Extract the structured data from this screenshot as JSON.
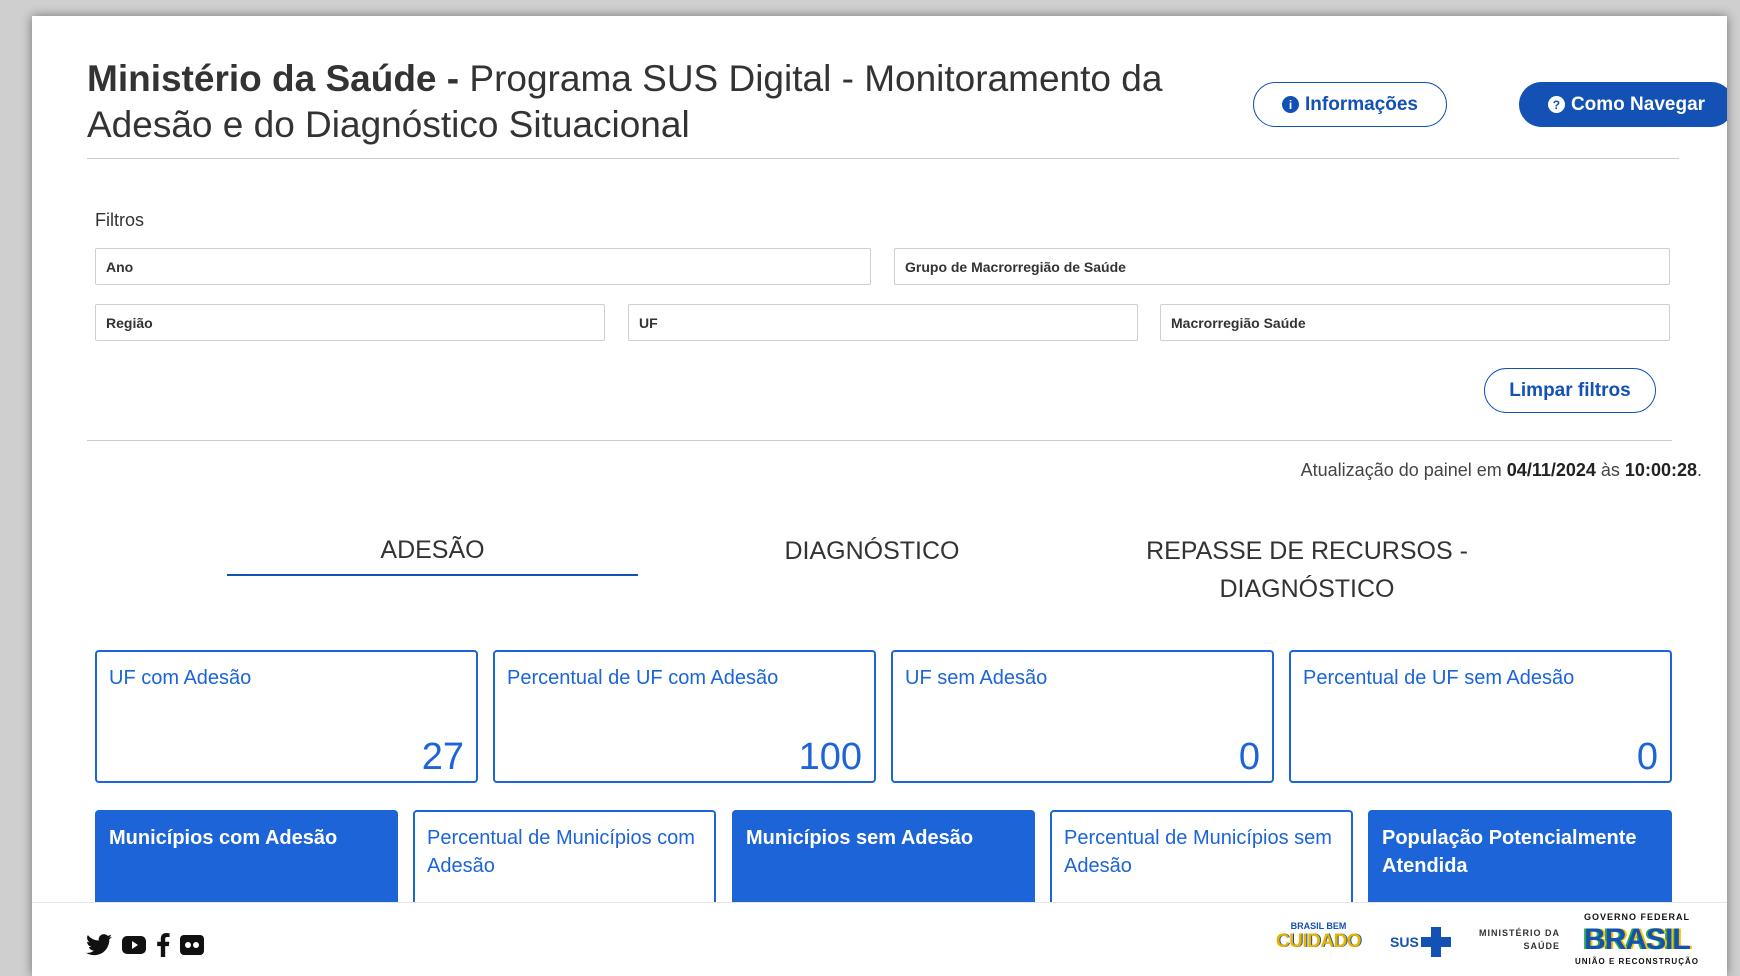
{
  "header": {
    "title_bold": "Ministério da Saúde -",
    "title_rest": " Programa SUS Digital - Monitoramento da Adesão e do Diagnóstico Situacional",
    "info_button": "Informações",
    "nav_button": "Como Navegar"
  },
  "filters": {
    "label": "Filtros",
    "ano": "Ano",
    "grupo_macro": "Grupo de Macrorregião de Saúde",
    "regiao": "Região",
    "uf": "UF",
    "macro_saude": "Macrorregião Saúde",
    "clear_button": "Limpar filtros"
  },
  "update": {
    "prefix": "Atualização do painel em ",
    "date": "04/11/2024",
    "middle": " às ",
    "time": "10:00:28",
    "suffix": "."
  },
  "tabs": [
    {
      "label": "ADESÃO",
      "active": true
    },
    {
      "label": "DIAGNÓSTICO",
      "active": false
    },
    {
      "label": "REPASSE DE RECURSOS - DIAGNÓSTICO",
      "active": false
    }
  ],
  "cards_top": [
    {
      "label": "UF com Adesão",
      "value": "27"
    },
    {
      "label": "Percentual de UF com Adesão",
      "value": "100"
    },
    {
      "label": "UF sem Adesão",
      "value": "0"
    },
    {
      "label": "Percentual de UF sem Adesão",
      "value": "0"
    }
  ],
  "cards_bottom": [
    {
      "label": "Municípios com Adesão",
      "style": "filled"
    },
    {
      "label": "Percentual de Municípios com Adesão",
      "style": "outline"
    },
    {
      "label": "Municípios sem Adesão",
      "style": "filled"
    },
    {
      "label": "Percentual de Municípios sem Adesão",
      "style": "outline"
    },
    {
      "label": "População Potencialmente Atendida",
      "style": "filled"
    }
  ],
  "footer": {
    "social_icons": [
      "twitter-icon",
      "youtube-icon",
      "facebook-icon",
      "flickr-icon"
    ],
    "logo_brasil_bem_cuidado_top": "BRASIL BEM",
    "logo_brasil_bem_cuidado_main": "CUIDADO",
    "logo_sus": "SUS",
    "logo_ministerio_line1": "MINISTÉRIO DA",
    "logo_ministerio_line2": "SAÚDE",
    "logo_gov_top": "GOVERNO FEDERAL",
    "logo_gov_main": "BRASIL",
    "logo_gov_bottom": "UNIÃO E RECONSTRUÇÃO"
  },
  "colors": {
    "primary": "#1351b4",
    "card_blue": "#1c64d8"
  }
}
